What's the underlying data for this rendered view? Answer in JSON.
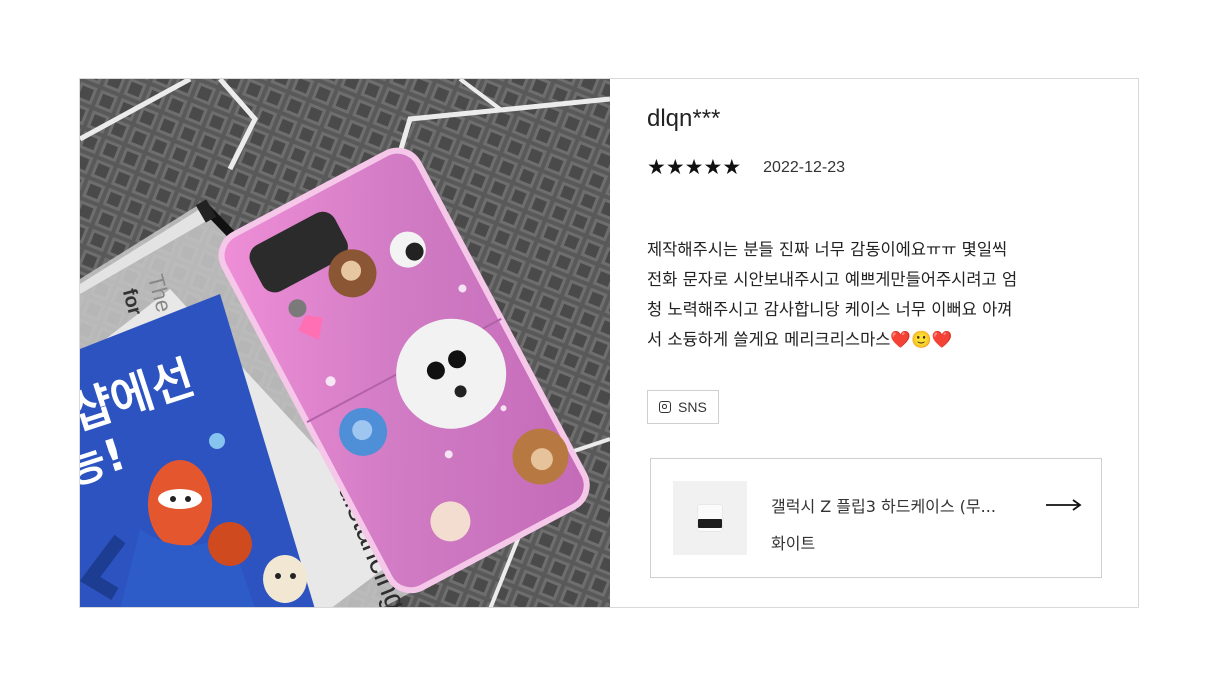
{
  "review": {
    "username": "dlqn***",
    "rating": 5,
    "rating_max": 5,
    "stars_display": [
      "★",
      "★",
      "★",
      "★",
      "★"
    ],
    "date": "2022-12-23",
    "text": "제작해주시는 분들 진짜 너무 감동이에요ㅠㅠ 몇일씩\n전화 문자로 시안보내주시고 예쁘게만들어주시려고 엄\n청 노력해주시고 감사합니당 케이스 너무 이뻐요 아껴\n서 소듕하게 쓸게요 메리크리스마스❤️🙂❤️",
    "source_badge": {
      "icon": "instagram-icon",
      "label": "SNS"
    }
  },
  "photo": {
    "poster_text_main": "샵에선",
    "poster_text_sub": "능!",
    "poster_text_en": "distancing.",
    "pouch_text": "The",
    "pouch_text_2": "for"
  },
  "product": {
    "name": "갤럭시 Z 플립3 하드케이스 (무...",
    "option": "화이트",
    "link_icon": "arrow-right-icon"
  },
  "colors": {
    "border": "#d9d9d9",
    "text": "#222222",
    "case_pink": "#d982c6",
    "poster_blue": "#2a4fb8"
  }
}
